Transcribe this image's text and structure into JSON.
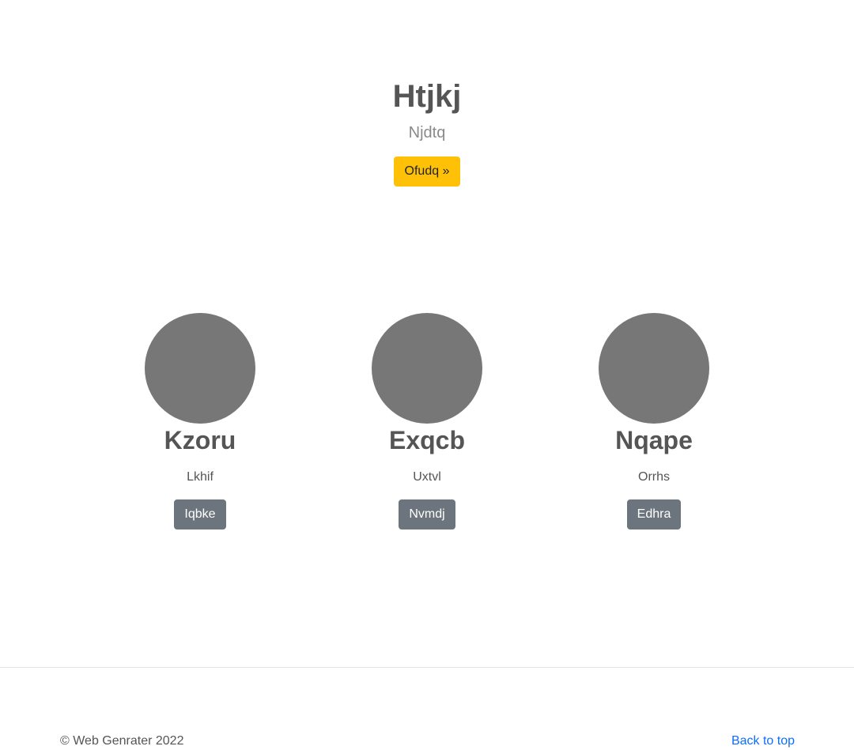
{
  "hero": {
    "title": "Htjkj",
    "subtitle": "Njdtq",
    "button_label": "Ofudq »"
  },
  "members": [
    {
      "name": "Kzoru",
      "role": "Lkhif",
      "button_label": "Iqbke"
    },
    {
      "name": "Exqcb",
      "role": "Uxtvl",
      "button_label": "Nvmdj"
    },
    {
      "name": "Nqape",
      "role": "Orrhs",
      "button_label": "Edhra"
    }
  ],
  "footer": {
    "copyright": "© Web Genrater 2022",
    "back_to_top": "Back to top"
  },
  "colors": {
    "hero_button": "#ffc107",
    "member_button": "#6c757d",
    "avatar_placeholder": "#777777",
    "link": "#0d6efd"
  }
}
